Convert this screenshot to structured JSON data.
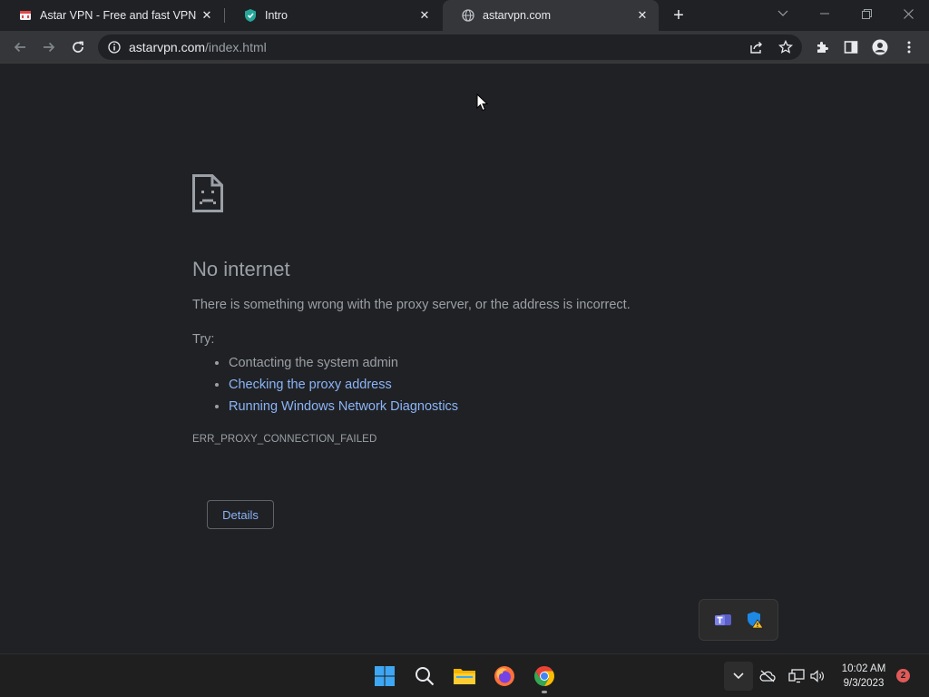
{
  "tabs": [
    {
      "title": "Astar VPN - Free and fast VPN fo",
      "favicon": "astar-vpn-favicon"
    },
    {
      "title": "Intro",
      "favicon": "shield-favicon"
    },
    {
      "title": "astarvpn.com",
      "favicon": "globe-icon",
      "active": true
    }
  ],
  "address_bar": {
    "host": "astarvpn.com",
    "path": "/index.html"
  },
  "error_page": {
    "icon": "sad-page-icon",
    "title": "No internet",
    "description": "There is something wrong with the proxy server, or the address is incorrect.",
    "try_label": "Try:",
    "suggestions": [
      {
        "text": "Contacting the system admin",
        "is_link": false
      },
      {
        "text": "Checking the proxy address",
        "is_link": true
      },
      {
        "text": "Running Windows Network Diagnostics",
        "is_link": true
      }
    ],
    "error_code": "ERR_PROXY_CONNECTION_FAILED",
    "details_button": "Details"
  },
  "taskbar": {
    "apps": [
      "windows-start-icon",
      "search-icon",
      "file-explorer-icon",
      "firefox-icon",
      "chrome-icon"
    ],
    "clock_time": "10:02 AM",
    "clock_date": "9/3/2023",
    "notification_count": "2"
  },
  "tray_flyout": {
    "icons": [
      "teams-icon",
      "defender-warning-icon"
    ]
  },
  "colors": {
    "background": "#202124",
    "toolbar": "#35363a",
    "link": "#8ab4f8",
    "text_muted": "#9aa0a6"
  }
}
